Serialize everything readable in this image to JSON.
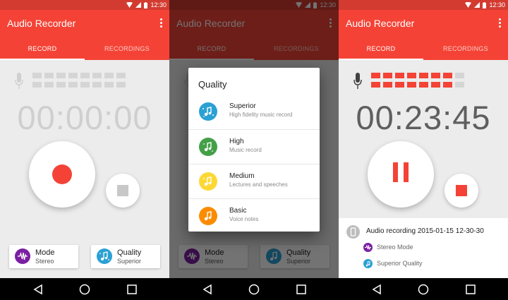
{
  "status_bar": {
    "time": "12:30"
  },
  "app": {
    "title": "Audio Recorder"
  },
  "tabs": {
    "record": "RECORD",
    "recordings": "RECORDINGS"
  },
  "screen1": {
    "timer": "00:00:00",
    "level_active_segments": 0,
    "mode": {
      "label": "Mode",
      "value": "Stereo"
    },
    "quality": {
      "label": "Quality",
      "value": "Superior"
    }
  },
  "quality_dialog": {
    "title": "Quality",
    "options": [
      {
        "name": "Superior",
        "description": "High fidelity music record",
        "color": "#2aa1d4",
        "icon": "superior-quality-icon"
      },
      {
        "name": "High",
        "description": "Music record",
        "color": "#43a047",
        "icon": "high-quality-icon"
      },
      {
        "name": "Medium",
        "description": "Lectures and speeches",
        "color": "#fdd835",
        "icon": "medium-quality-icon"
      },
      {
        "name": "Basic",
        "description": "Voice notes",
        "color": "#fb8c00",
        "icon": "basic-quality-icon"
      }
    ]
  },
  "screen3": {
    "timer": "00:23:45",
    "level_active_segments": 7,
    "recording": {
      "name": "Audio recording 2015-01-15 12-30-30",
      "mode": "Stereo Mode",
      "quality": "Superior Quality"
    }
  },
  "colors": {
    "accent": "#f44336",
    "status_bar": "#d33b31",
    "mode": "#7b1fa2",
    "quality": "#2aa1d4"
  }
}
